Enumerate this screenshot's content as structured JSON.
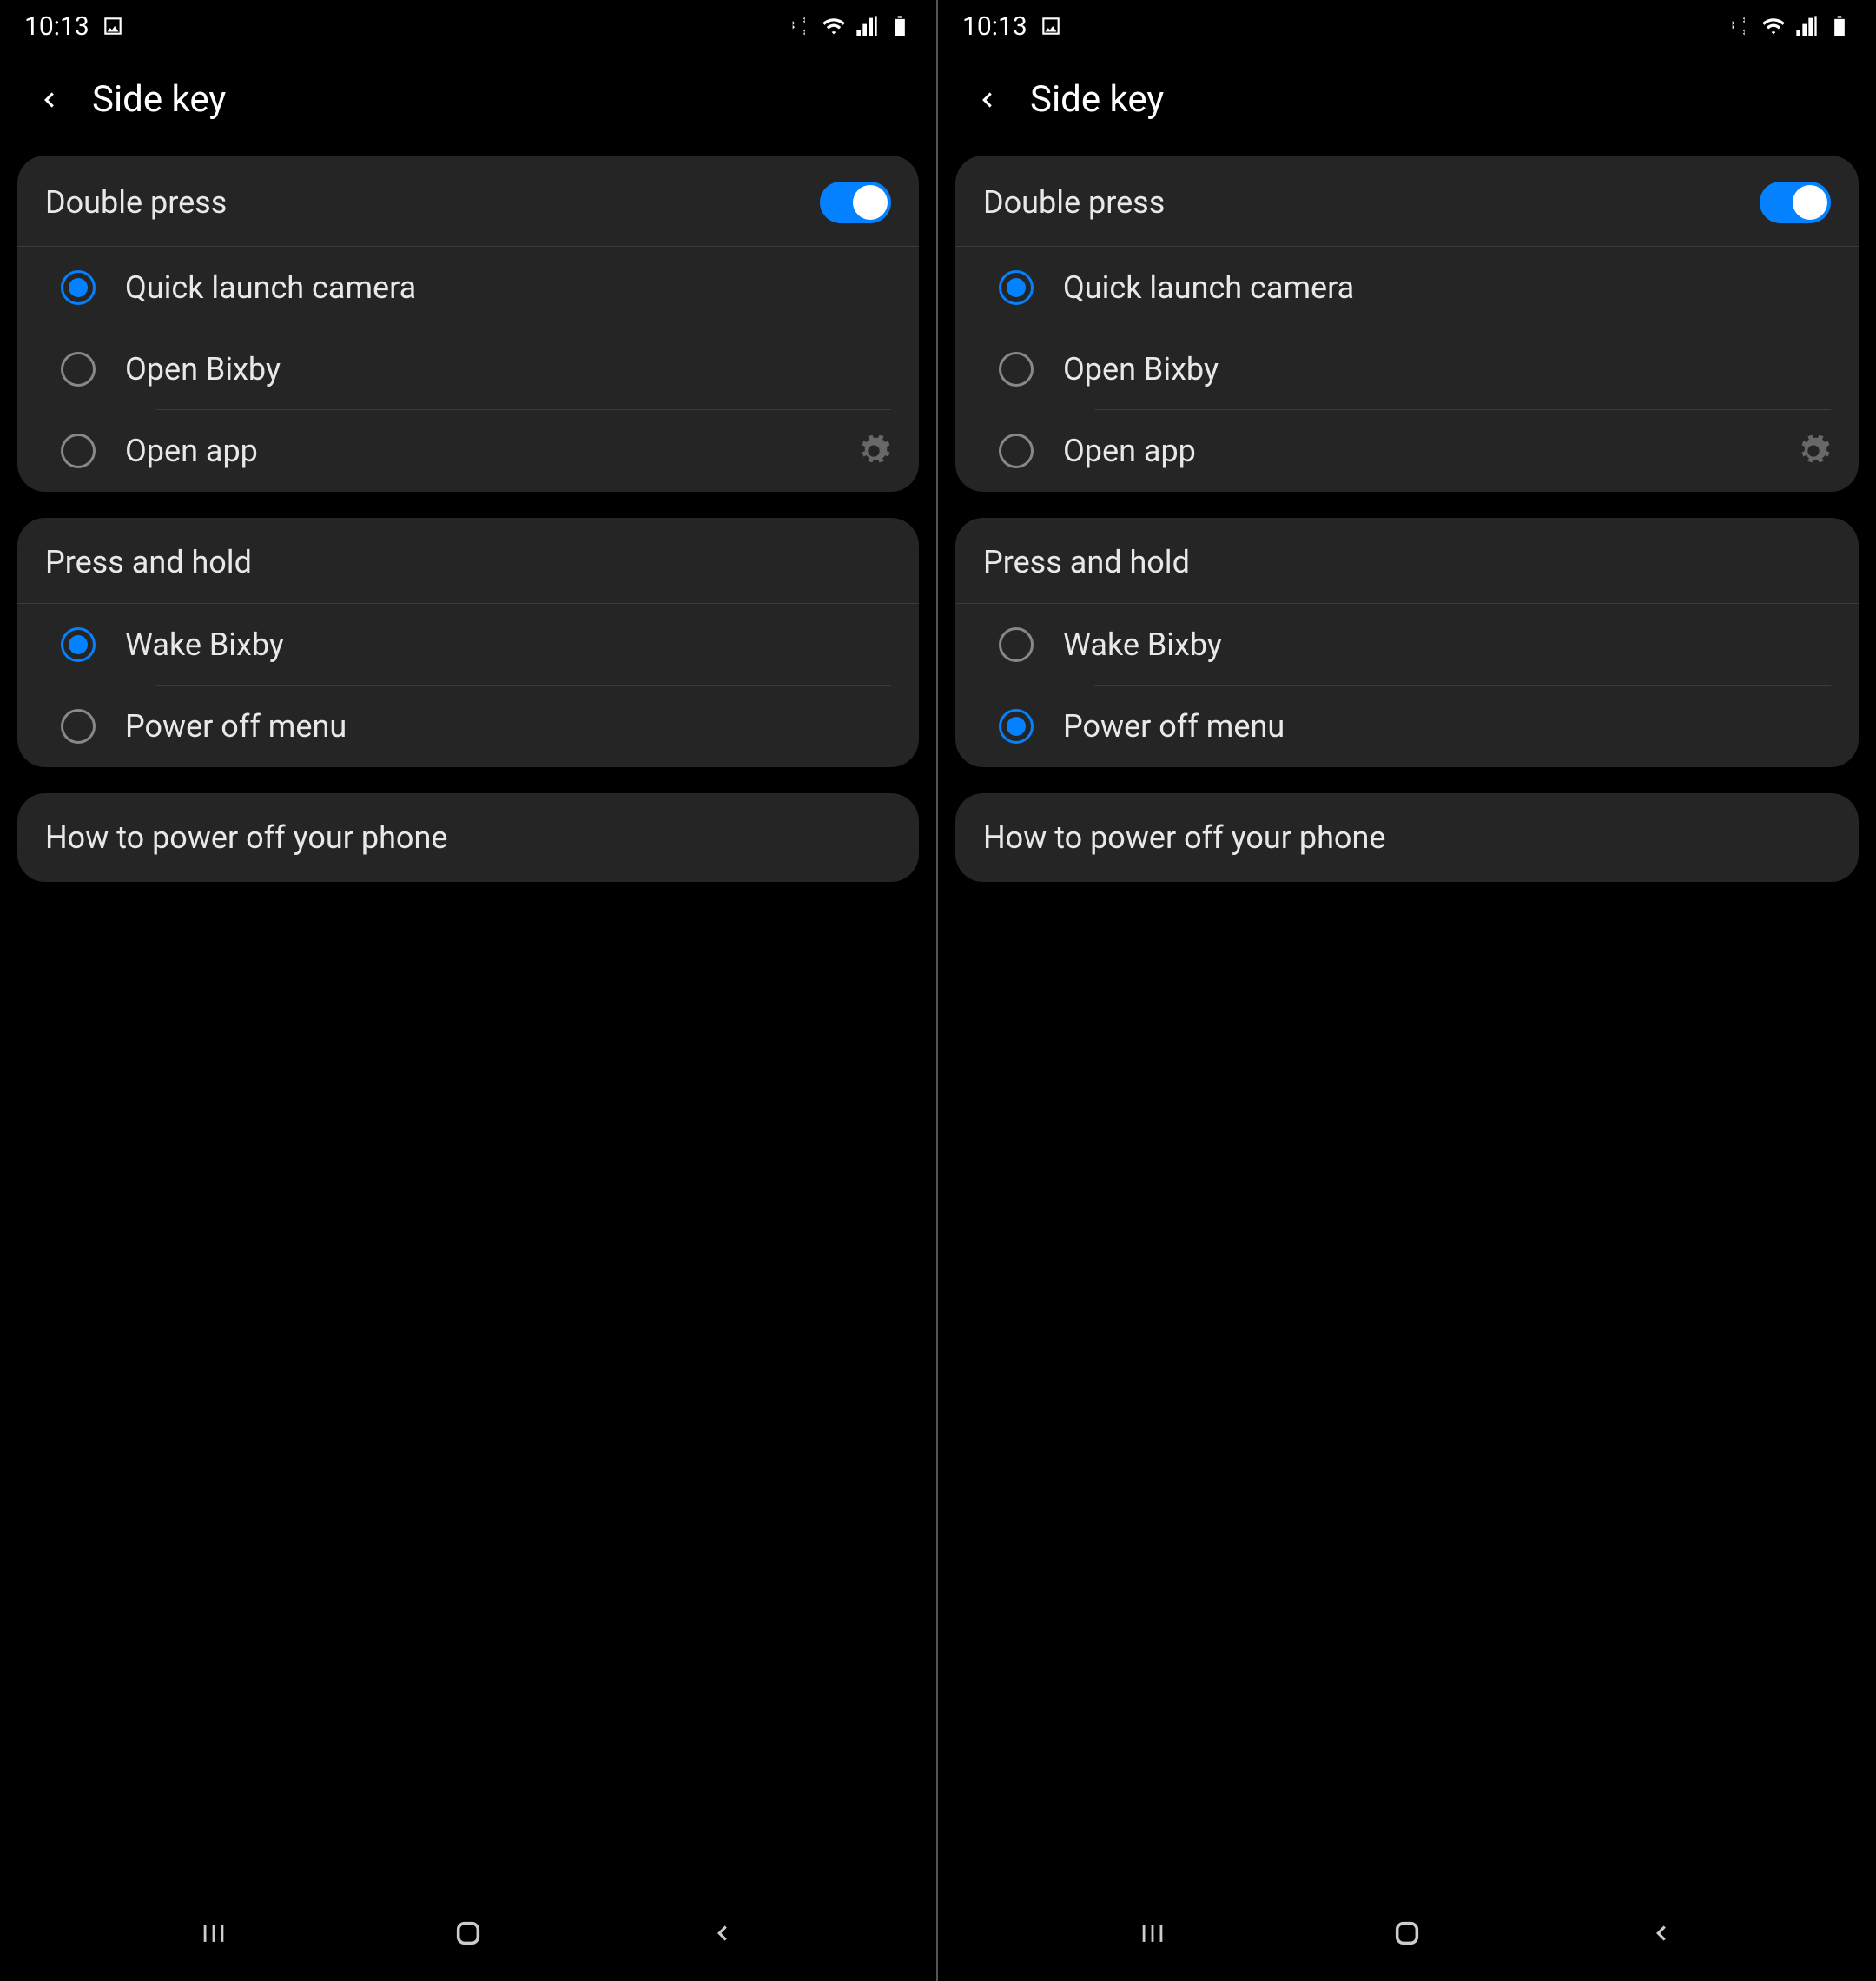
{
  "status": {
    "time": "10:13"
  },
  "header": {
    "title": "Side key"
  },
  "screens": [
    {
      "doublePress": {
        "title": "Double press",
        "toggle": true,
        "options": [
          {
            "label": "Quick launch camera",
            "selected": true
          },
          {
            "label": "Open Bixby",
            "selected": false
          },
          {
            "label": "Open app",
            "selected": false,
            "hasGear": true
          }
        ]
      },
      "pressHold": {
        "title": "Press and hold",
        "options": [
          {
            "label": "Wake Bixby",
            "selected": true
          },
          {
            "label": "Power off menu",
            "selected": false
          }
        ]
      },
      "info": "How to power off your phone"
    },
    {
      "doublePress": {
        "title": "Double press",
        "toggle": true,
        "options": [
          {
            "label": "Quick launch camera",
            "selected": true
          },
          {
            "label": "Open Bixby",
            "selected": false
          },
          {
            "label": "Open app",
            "selected": false,
            "hasGear": true
          }
        ]
      },
      "pressHold": {
        "title": "Press and hold",
        "options": [
          {
            "label": "Wake Bixby",
            "selected": false
          },
          {
            "label": "Power off menu",
            "selected": true
          }
        ]
      },
      "info": "How to power off your phone"
    }
  ]
}
